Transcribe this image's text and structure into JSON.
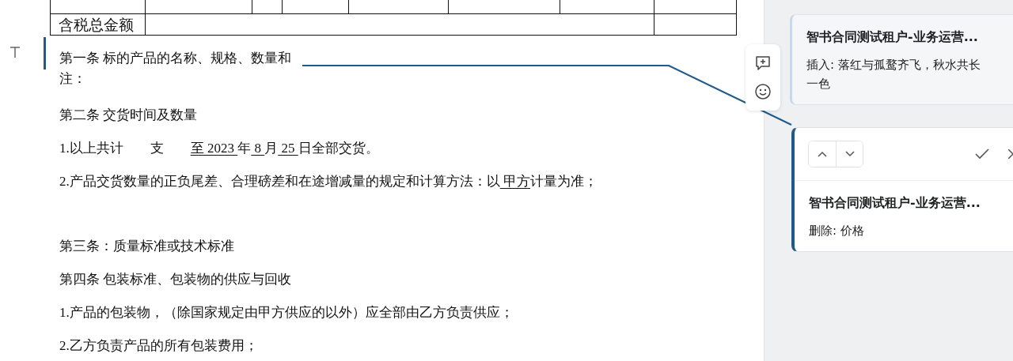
{
  "table": {
    "total_label": "含税总金额"
  },
  "paragraphs": [
    {
      "kind": "tracked",
      "segments": [
        {
          "text": "第一条  标的产品的名称、规格、数量和",
          "underlined": false
        }
      ],
      "continuation": "注："
    },
    {
      "kind": "text",
      "segments": [
        {
          "text": "第二条  交货时间及数量",
          "underlined": false
        }
      ]
    },
    {
      "kind": "text",
      "segments": [
        {
          "text": "1.以上共计　　支　　",
          "underlined": false
        },
        {
          "text": "至 2023 ",
          "underlined": true
        },
        {
          "text": "年",
          "underlined": false
        },
        {
          "text": " 8 ",
          "underlined": true
        },
        {
          "text": "月",
          "underlined": false
        },
        {
          "text": " 25 ",
          "underlined": true
        },
        {
          "text": "日全部交货。",
          "underlined": false
        }
      ]
    },
    {
      "kind": "text",
      "segments": [
        {
          "text": "2.产品交货数量的正负尾差、合理磅差和在途增减量的规定和计算方法：以",
          "underlined": false
        },
        {
          "text": " 甲方",
          "underlined": true
        },
        {
          "text": "计量为准；",
          "underlined": false
        }
      ]
    },
    {
      "kind": "blank"
    },
    {
      "kind": "text",
      "segments": [
        {
          "text": "第三条：质量标准或技术标准",
          "underlined": false
        }
      ]
    },
    {
      "kind": "text",
      "segments": [
        {
          "text": "第四条  包装标准、包装物的供应与回收",
          "underlined": false
        }
      ]
    },
    {
      "kind": "text",
      "segments": [
        {
          "text": "1.产品的包装物，（除国家规定由甲方供应的以外）应全部由乙方负责供应；",
          "underlined": false
        }
      ]
    },
    {
      "kind": "text",
      "segments": [
        {
          "text": "2.乙方负责产品的所有包装费用；",
          "underlined": false
        }
      ]
    }
  ],
  "comments": [
    {
      "selected": false,
      "author": "智书合同测试租户-业务运营...",
      "lines": [
        "插入: 落红与孤鹜齐飞，秋水共长",
        "一色"
      ]
    },
    {
      "selected": true,
      "author": "智书合同测试租户-业务运营...",
      "lines": [
        "删除: 价格"
      ]
    }
  ]
}
